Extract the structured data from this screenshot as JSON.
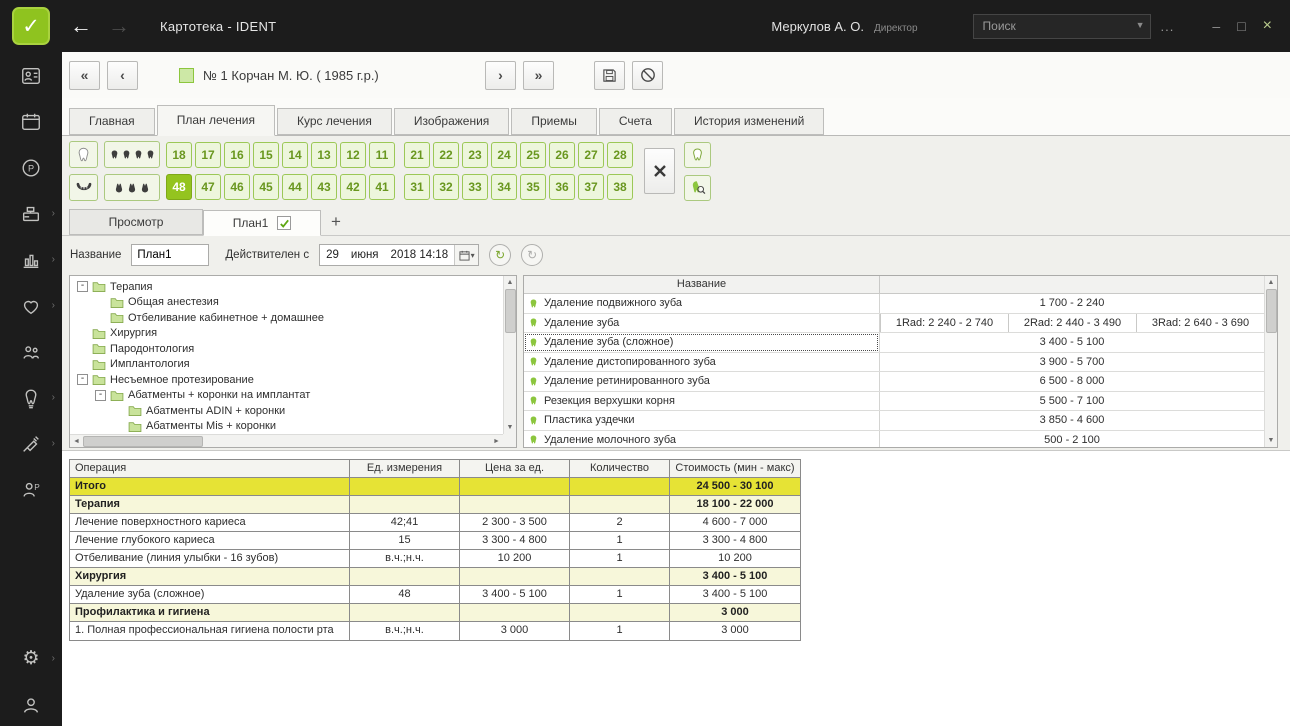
{
  "titlebar": {
    "title": "Картотека  -  IDENT",
    "user_name": "Меркулов А. О.",
    "user_role": "Директор",
    "search_placeholder": "Поиск",
    "more_label": "..."
  },
  "sidebar": {
    "icons": [
      "patient-card",
      "calendar",
      "phone-calls",
      "cash-register",
      "reports",
      "treatment",
      "staff",
      "implants",
      "anesthesia",
      "assistant",
      "settings",
      "profile"
    ]
  },
  "patient_bar": {
    "patient": "№ 1 Корчан М. Ю. ( 1985 г.р.)"
  },
  "main_tabs": [
    {
      "label": "Главная",
      "cls": ""
    },
    {
      "label": "План лечения",
      "cls": "active"
    },
    {
      "label": "Курс лечения",
      "cls": ""
    },
    {
      "label": "Изображения",
      "cls": ""
    },
    {
      "label": "Приемы",
      "cls": ""
    },
    {
      "label": "Счета",
      "cls": ""
    },
    {
      "label": "История изменений",
      "cls": ""
    }
  ],
  "teeth": {
    "upper_left": [
      "18",
      "17",
      "16",
      "15",
      "14",
      "13",
      "12",
      "11"
    ],
    "upper_right": [
      "21",
      "22",
      "23",
      "24",
      "25",
      "26",
      "27",
      "28"
    ],
    "lower_left": [
      "48",
      "47",
      "46",
      "45",
      "44",
      "43",
      "42",
      "41"
    ],
    "lower_right": [
      "31",
      "32",
      "33",
      "34",
      "35",
      "36",
      "37",
      "38"
    ],
    "selected": "48"
  },
  "plan_tabs": {
    "view": "Просмотр",
    "active_plan": "План1",
    "add": "+"
  },
  "plan_form": {
    "name_label": "Название",
    "name_value": "План1",
    "valid_from_label": "Действителен с",
    "date_day": "29",
    "date_month": "июня",
    "date_time": "2018 14:18"
  },
  "tree": [
    {
      "label": "Терапия",
      "exp": "-",
      "cls": "lvl0"
    },
    {
      "label": "Общая анестезия",
      "exp": "",
      "cls": "lvl1 noexp"
    },
    {
      "label": "Отбеливание кабинетное + домашнее",
      "exp": "",
      "cls": "lvl1 noexp"
    },
    {
      "label": "Хирургия",
      "exp": "",
      "cls": "lvl0 noexp"
    },
    {
      "label": "Пародонтология",
      "exp": "",
      "cls": "lvl0 noexp"
    },
    {
      "label": "Имплантология",
      "exp": "",
      "cls": "lvl0 noexp"
    },
    {
      "label": "Несъемное протезирование",
      "exp": "-",
      "cls": "lvl0"
    },
    {
      "label": "Абатменты + коронки на имплантат",
      "exp": "-",
      "cls": "lvl1"
    },
    {
      "label": "Абатменты ADIN + коронки",
      "exp": "",
      "cls": "lvl2 noexp"
    },
    {
      "label": "Абатменты Mis + коронки",
      "exp": "",
      "cls": "lvl2 noexp"
    }
  ],
  "price_list": {
    "header": "Название",
    "rows": [
      {
        "label": "Удаление подвижного зуба",
        "price": "1 700 - 2 240",
        "cls": ""
      },
      {
        "label": "Удаление зуба",
        "p1": "1Rad: 2 240 - 2 740",
        "p2": "2Rad: 2 440 - 3 490",
        "p3": "3Rad: 2 640 - 3 690",
        "cls": "multi"
      },
      {
        "label": "Удаление зуба (сложное)",
        "price": "3 400 - 5 100",
        "cls": "selected"
      },
      {
        "label": "Удаление дистопированного зуба",
        "price": "3 900 - 5 700",
        "cls": ""
      },
      {
        "label": "Удаление ретинированного зуба",
        "price": "6 500 - 8 000",
        "cls": ""
      },
      {
        "label": "Резекция верхушки корня",
        "price": "5 500 - 7 100",
        "cls": ""
      },
      {
        "label": "Пластика уздечки",
        "price": "3 850 - 4 600",
        "cls": ""
      },
      {
        "label": "Удаление молочного зуба",
        "price": "500 - 2 100",
        "cls": ""
      }
    ]
  },
  "operations": {
    "columns": [
      "Операция",
      "Ед. измерения",
      "Цена за ед.",
      "Количество",
      "Стоимость (мин - макс)"
    ],
    "rows": [
      {
        "op": "Итого",
        "unit": "",
        "price": "",
        "qty": "",
        "total": "24 500 - 30 100",
        "cls": "total"
      },
      {
        "op": "Терапия",
        "unit": "",
        "price": "",
        "qty": "",
        "total": "18 100 - 22 000",
        "cls": "section"
      },
      {
        "op": "Лечение поверхностного кариеса",
        "unit": "42;41",
        "price": "2 300 - 3 500",
        "qty": "2",
        "total": "4 600 - 7 000",
        "cls": ""
      },
      {
        "op": "Лечение глубокого кариеса",
        "unit": "15",
        "price": "3 300 - 4 800",
        "qty": "1",
        "total": "3 300 - 4 800",
        "cls": ""
      },
      {
        "op": "Отбеливание (линия улыбки - 16 зубов)",
        "unit": "в.ч.;н.ч.",
        "price": "10 200",
        "qty": "1",
        "total": "10 200",
        "cls": ""
      },
      {
        "op": "Хирургия",
        "unit": "",
        "price": "",
        "qty": "",
        "total": "3 400 - 5 100",
        "cls": "section"
      },
      {
        "op": "Удаление зуба (сложное)",
        "unit": "48",
        "price": "3 400 - 5 100",
        "qty": "1",
        "total": "3 400 - 5 100",
        "cls": ""
      },
      {
        "op": "Профилактика и гигиена",
        "unit": "",
        "price": "",
        "qty": "",
        "total": "3 000",
        "cls": "section"
      },
      {
        "op": "1. Полная профессиональная гигиена полости рта",
        "unit": "в.ч.;н.ч.",
        "price": "3 000",
        "qty": "1",
        "total": "3 000",
        "cls": ""
      }
    ]
  },
  "colors": {
    "accent_green": "#8FC31F",
    "total_yellow": "#E6E335",
    "section_yellow": "#F7F7DA"
  }
}
